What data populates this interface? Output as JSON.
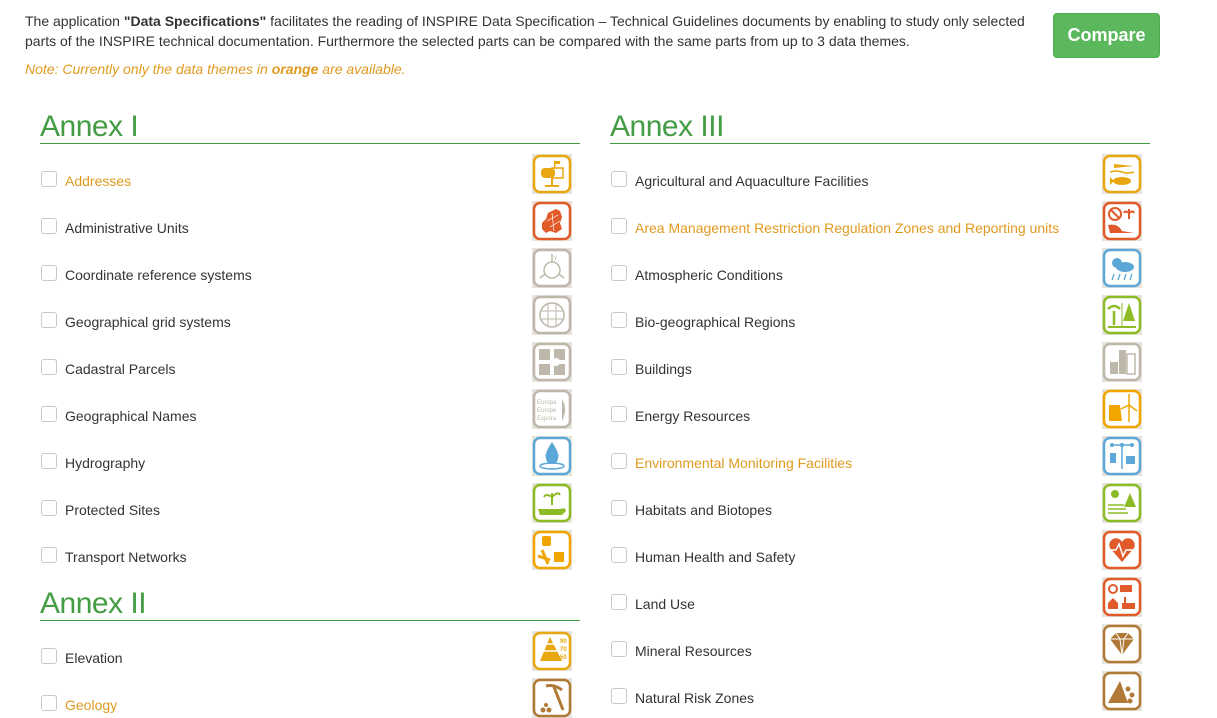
{
  "intro": {
    "prefix": "The application ",
    "app_name": "\"Data Specifications\"",
    "suffix": " facilitates the reading of INSPIRE Data Specification – Technical Guidelines documents by enabling to study only selected parts of the INSPIRE technical documentation. Furthermore the selected parts can be compared with the same parts from up to 3 data themes."
  },
  "note": {
    "prefix": "Note: Currently only the data themes in ",
    "highlight": "orange",
    "suffix": " are available."
  },
  "compare_button": {
    "label": "Compare",
    "color": "#5cb85c"
  },
  "colors": {
    "available": "#e09a1f",
    "heading": "#449d44",
    "text": "#333333"
  },
  "annex1": {
    "title": "Annex I",
    "items": [
      {
        "label": "Addresses",
        "available": true,
        "icon": "mailbox-icon",
        "icon_color": "#e8a70f",
        "checked": false
      },
      {
        "label": "Administrative Units",
        "available": false,
        "icon": "europe-map-icon",
        "icon_color": "#e05a2a",
        "checked": false
      },
      {
        "label": "Coordinate reference systems",
        "available": false,
        "icon": "globe-axes-icon",
        "icon_color": "#bdb8aa",
        "checked": false
      },
      {
        "label": "Geographical grid systems",
        "available": false,
        "icon": "grid-globe-icon",
        "icon_color": "#bdb8aa",
        "checked": false
      },
      {
        "label": "Cadastral Parcels",
        "available": false,
        "icon": "parcels-icon",
        "icon_color": "#bdb8aa",
        "checked": false
      },
      {
        "label": "Geographical Names",
        "available": false,
        "icon": "names-icon",
        "icon_color": "#bdb8aa",
        "checked": false
      },
      {
        "label": "Hydrography",
        "available": false,
        "icon": "water-drop-icon",
        "icon_color": "#5aa7d8",
        "checked": false
      },
      {
        "label": "Protected Sites",
        "available": false,
        "icon": "plant-hand-icon",
        "icon_color": "#8dbb25",
        "checked": false
      },
      {
        "label": "Transport Networks",
        "available": false,
        "icon": "transport-icon",
        "icon_color": "#f0a500",
        "checked": false
      }
    ]
  },
  "annex2": {
    "title": "Annex II",
    "items": [
      {
        "label": "Elevation",
        "available": false,
        "icon": "elevation-icon",
        "icon_color": "#e8a70f",
        "checked": false
      },
      {
        "label": "Geology",
        "available": true,
        "icon": "pickaxe-icon",
        "icon_color": "#b07a36",
        "checked": false
      }
    ]
  },
  "annex3": {
    "title": "Annex III",
    "items": [
      {
        "label": "Agricultural and Aquaculture Facilities",
        "available": false,
        "icon": "carrot-fish-icon",
        "icon_color": "#e8a70f",
        "checked": false
      },
      {
        "label": "Area Management Restriction Regulation Zones and Reporting units",
        "available": true,
        "icon": "restriction-icon",
        "icon_color": "#e05a2a",
        "checked": false
      },
      {
        "label": "Atmospheric Conditions",
        "available": false,
        "icon": "weather-icon",
        "icon_color": "#5aa7d8",
        "checked": false
      },
      {
        "label": "Bio-geographical Regions",
        "available": false,
        "icon": "palm-pine-icon",
        "icon_color": "#8dbb25",
        "checked": false
      },
      {
        "label": "Buildings",
        "available": false,
        "icon": "buildings-icon",
        "icon_color": "#bdb8aa",
        "checked": false
      },
      {
        "label": "Energy Resources",
        "available": false,
        "icon": "wind-turbine-icon",
        "icon_color": "#f0a500",
        "checked": false
      },
      {
        "label": "Environmental Monitoring Facilities",
        "available": true,
        "icon": "monitoring-station-icon",
        "icon_color": "#5aa7d8",
        "checked": false
      },
      {
        "label": "Habitats and Biotopes",
        "available": false,
        "icon": "habitat-icon",
        "icon_color": "#8dbb25",
        "checked": false
      },
      {
        "label": "Human Health and Safety",
        "available": false,
        "icon": "heart-pulse-icon",
        "icon_color": "#e05a2a",
        "checked": false
      },
      {
        "label": "Land Use",
        "available": false,
        "icon": "land-use-icon",
        "icon_color": "#e05a2a",
        "checked": false
      },
      {
        "label": "Mineral Resources",
        "available": false,
        "icon": "diamond-icon",
        "icon_color": "#b07a36",
        "checked": false
      },
      {
        "label": "Natural Risk Zones",
        "available": false,
        "icon": "rockfall-icon",
        "icon_color": "#b07a36",
        "checked": false
      }
    ]
  }
}
